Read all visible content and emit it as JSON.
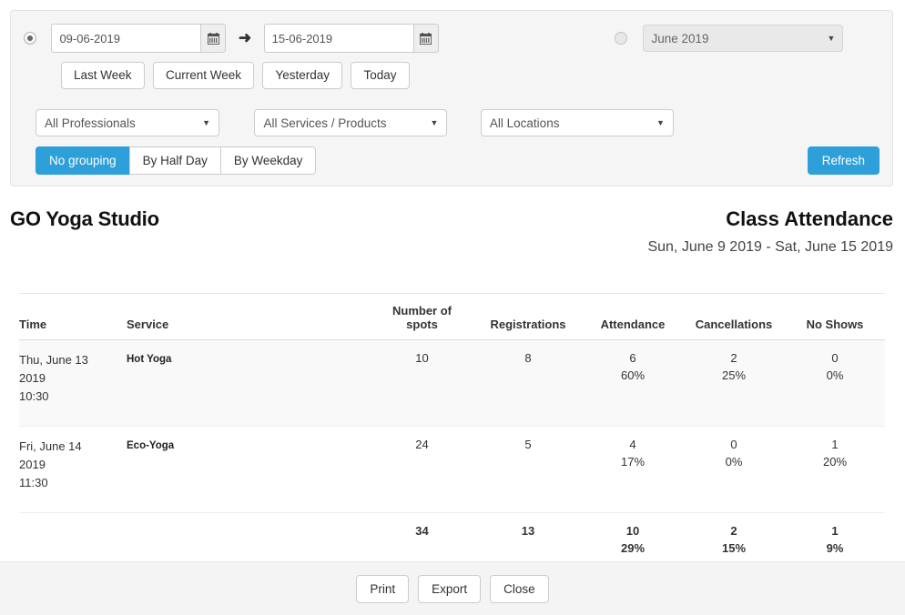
{
  "toolbar": {
    "date_range_radio_selected": true,
    "start_date": "09-06-2019",
    "end_date": "15-06-2019",
    "date_placeholder": "dd-mm-yyyy",
    "arrow_glyph": "➜",
    "quick_buttons": [
      {
        "label": "Last Week"
      },
      {
        "label": "Current Week"
      },
      {
        "label": "Yesterday"
      },
      {
        "label": "Today"
      }
    ],
    "month_radio_selected": false,
    "month_value": "June 2019",
    "filters": [
      {
        "name": "professionals",
        "value": "All Professionals"
      },
      {
        "name": "services",
        "value": "All Services / Products"
      },
      {
        "name": "locations",
        "value": "All Locations"
      }
    ],
    "grouping": {
      "options": [
        "No grouping",
        "By Half Day",
        "By Weekday"
      ],
      "active_index": 0,
      "active_color": "#2d9fd9"
    },
    "refresh_label": "Refresh"
  },
  "report": {
    "studio_name": "GO Yoga Studio",
    "title": "Class Attendance",
    "date_range": "Sun, June 9 2019 - Sat, June 15 2019"
  },
  "table": {
    "headers": {
      "time": "Time",
      "service": "Service",
      "spots_l1": "Number of",
      "spots_l2": "spots",
      "registrations": "Registrations",
      "attendance": "Attendance",
      "cancellations": "Cancellations",
      "no_shows": "No Shows"
    },
    "rows": [
      {
        "day": "Thu, June 13",
        "year": "2019",
        "time": "10:30",
        "service": "Hot Yoga",
        "spots": "10",
        "registrations": "8",
        "attendance": "6",
        "attendance_pct": "60%",
        "cancellations": "2",
        "cancellations_pct": "25%",
        "no_shows": "0",
        "no_shows_pct": "0%"
      },
      {
        "day": "Fri, June 14",
        "year": "2019",
        "time": "11:30",
        "service": "Eco-Yoga",
        "spots": "24",
        "registrations": "5",
        "attendance": "4",
        "attendance_pct": "17%",
        "cancellations": "0",
        "cancellations_pct": "0%",
        "no_shows": "1",
        "no_shows_pct": "20%"
      }
    ],
    "totals": {
      "spots": "34",
      "registrations": "13",
      "attendance": "10",
      "attendance_pct": "29%",
      "cancellations": "2",
      "cancellations_pct": "15%",
      "no_shows": "1",
      "no_shows_pct": "9%"
    }
  },
  "footer": {
    "buttons": [
      {
        "label": "Print"
      },
      {
        "label": "Export"
      },
      {
        "label": "Close"
      }
    ]
  }
}
